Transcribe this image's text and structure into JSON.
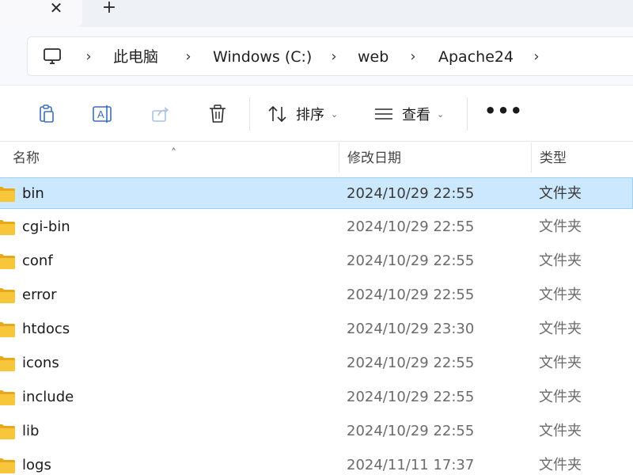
{
  "tabs": {
    "close_glyph": "✕",
    "new_tab_glyph": "+"
  },
  "address": {
    "root_icon": "computer-icon",
    "crumbs": [
      "此电脑",
      "Windows (C:)",
      "web",
      "Apache24"
    ],
    "separator_glyph": "›"
  },
  "toolbar": {
    "buttons": [
      "copy-icon",
      "rename-icon",
      "share-icon",
      "delete-icon"
    ],
    "sort_label": "排序",
    "view_label": "查看",
    "more_glyph": "•••",
    "dropdown_glyph": "⌄"
  },
  "columns": {
    "name": "名称",
    "modified": "修改日期",
    "type": "类型",
    "sort_glyph": "˄"
  },
  "files": [
    {
      "name": "bin",
      "modified": "2024/10/29 22:55",
      "type": "文件夹",
      "selected": true
    },
    {
      "name": "cgi-bin",
      "modified": "2024/10/29 22:55",
      "type": "文件夹"
    },
    {
      "name": "conf",
      "modified": "2024/10/29 22:55",
      "type": "文件夹"
    },
    {
      "name": "error",
      "modified": "2024/10/29 22:55",
      "type": "文件夹"
    },
    {
      "name": "htdocs",
      "modified": "2024/10/29 23:30",
      "type": "文件夹"
    },
    {
      "name": "icons",
      "modified": "2024/10/29 22:55",
      "type": "文件夹"
    },
    {
      "name": "include",
      "modified": "2024/10/29 22:55",
      "type": "文件夹"
    },
    {
      "name": "lib",
      "modified": "2024/10/29 22:55",
      "type": "文件夹"
    },
    {
      "name": "logs",
      "modified": "2024/11/11 17:37",
      "type": "文件夹"
    }
  ],
  "colors": {
    "selection_bg": "#cce8ff",
    "selection_border": "#99d1ff",
    "folder_yellow": "#f8c63a"
  }
}
